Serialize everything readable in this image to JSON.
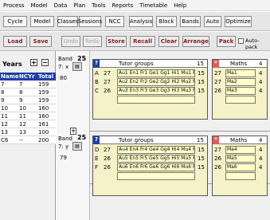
{
  "menu": [
    "Process",
    "Model",
    "Data",
    "Plan",
    "Tools",
    "Reports",
    "Timetable",
    "Help"
  ],
  "toolbar1": [
    "Cycle",
    "Model",
    "Classes",
    "Sessions",
    "NCC",
    "Analysis",
    "Block",
    "Bands",
    "Auto",
    "Optimize"
  ],
  "toolbar2": {
    "load": "Load",
    "save": "Save",
    "undo": "Undo",
    "redo": "Redo",
    "store": "Store",
    "recall": "Recall",
    "clear": "Clear",
    "arrange": "Arrange",
    "pack": "Pack",
    "autopack": "Auto-pack"
  },
  "years": {
    "title": "Years",
    "plus": "+",
    "minus": "−",
    "headers": [
      "Name",
      "NCYr",
      "Total"
    ],
    "rows": [
      [
        "7",
        "7",
        "159"
      ],
      [
        "8",
        "8",
        "159"
      ],
      [
        "9",
        "9",
        "159"
      ],
      [
        "10",
        "10",
        "160"
      ],
      [
        "11",
        "11",
        "160"
      ],
      [
        "12",
        "12",
        "161"
      ],
      [
        "13",
        "13",
        "100"
      ],
      [
        "C6",
        "--",
        "200"
      ]
    ]
  },
  "bands": [
    {
      "label": "Band",
      "num": "25",
      "code": "7: x",
      "total": "80",
      "groups": {
        "mark": "?",
        "title": "Tutor groups",
        "count": "15",
        "rows": [
          {
            "letter": "A",
            "n": "27",
            "cell": "Au1 En1 Fr1 Ge1 Gg1 Hi1 Mu1 Re1 Sc1",
            "count": "15"
          },
          {
            "letter": "B",
            "n": "27",
            "cell": "Au2 En2 Fr2 Ge2 Gg2 Hi2 Mu2 Re2 Sc2",
            "count": "15"
          },
          {
            "letter": "C",
            "n": "26",
            "cell": "Au3 En3 Fr3 Ge3 Gg3 Hi3 Mu3 Re3 Sc3",
            "count": "15"
          }
        ]
      },
      "subject": {
        "mark": "*",
        "title": "Maths",
        "count": "4",
        "rows": [
          {
            "n": "27",
            "cell": "Ma1",
            "count": "4"
          },
          {
            "n": "27",
            "cell": "Ma2",
            "count": "4"
          },
          {
            "n": "26",
            "cell": "Ma3",
            "count": "4"
          }
        ]
      }
    },
    {
      "label": "Band",
      "num": "25",
      "code": "7: y",
      "total": "79",
      "groups": {
        "mark": "?",
        "title": "Tutor groups",
        "count": "15",
        "rows": [
          {
            "letter": "D",
            "n": "27",
            "cell": "Au4 En4 Fr4 Ge4 Gg4 Hi4 Mu4 Re4 Sc4",
            "count": "15"
          },
          {
            "letter": "E",
            "n": "26",
            "cell": "Au5 En5 Fr5 Ge5 Gg5 Hi5 Mu5 Re5 Sc5",
            "count": "15"
          },
          {
            "letter": "F",
            "n": "26",
            "cell": "Au6 En6 Fr6 Ge6 Gg6 Hi6 Mu6 Re6 Sc6",
            "count": "15"
          }
        ]
      },
      "subject": {
        "mark": "*",
        "title": "Maths",
        "count": "4",
        "rows": [
          {
            "n": "27",
            "cell": "Ma4",
            "count": "4"
          },
          {
            "n": "26",
            "cell": "Ma5",
            "count": "4"
          },
          {
            "n": "26",
            "cell": "Ma6",
            "count": "4"
          }
        ]
      }
    }
  ],
  "colors": {
    "accent_blue": "#1f3fa6",
    "alert_red": "#e35a5a",
    "block_bg": "#f5f1c8",
    "cell_bg": "#ffffc8",
    "button_text": "#8b1a1a"
  }
}
